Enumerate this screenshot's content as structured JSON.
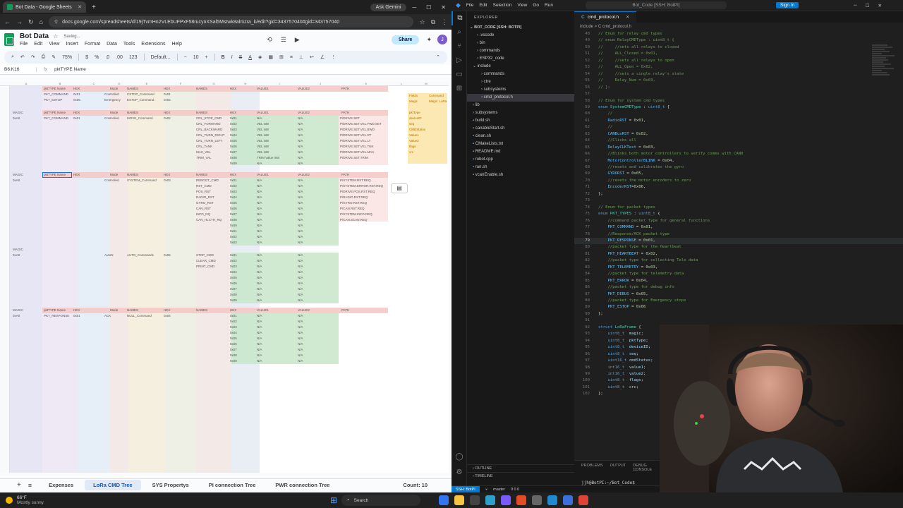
{
  "browser": {
    "tab_title": "Bot Data - Google Sheets",
    "new_tab": "+",
    "ask_gemini": "Ask Gemini",
    "url": "docs.google.com/spreadsheets/d/19jTvmHn2VLEbUFPxF58rucynXSal5Mstwk8almzra_k/edit?gid=343757040#gid=343757040"
  },
  "sheets": {
    "title": "Bot Data",
    "saving": "Saving...",
    "menus": [
      "File",
      "Edit",
      "View",
      "Insert",
      "Format",
      "Data",
      "Tools",
      "Extensions",
      "Help"
    ],
    "share": "Share",
    "avatar": "J",
    "toolbar": {
      "zoom": "75%",
      "font": "Default...",
      "font_size": "10",
      "currency": "$",
      "percent": "%",
      "decimals": ".0",
      "decimals2": ".00",
      "numfmt": "123",
      "bold": "B",
      "italic": "I",
      "strike": "S",
      "color": "A"
    },
    "namebox": "B6:K16",
    "formula": "pktTYPE Name",
    "col_letters": [
      "A",
      "B",
      "C",
      "D",
      "E",
      "F",
      "G",
      "H",
      "I",
      "J",
      "K",
      "L",
      "M"
    ],
    "sheet_tabs": [
      "Expenses",
      "LoRa CMD Tree",
      "SYS Propertys",
      "PI connection Tree",
      "PWR connection Tree"
    ],
    "count": "Count: 10",
    "rows": {
      "r1": [
        "pktTYPE Name",
        "HEX",
        "Mode",
        "NAMES",
        "HEX",
        "NAMES",
        "HEX",
        "VALUE1",
        "VALUE2",
        "PATH"
      ],
      "r2": [
        "PKT_COMMAND",
        "0x01",
        "Controlled",
        "CSTOP_Command",
        "0x01"
      ],
      "r3": [
        "PKT_ESTOP",
        "0x06",
        "Emergency",
        "ESTOP_Command",
        "0x02"
      ],
      "fields": [
        "Fields",
        "Command",
        "Magic",
        "Magic: LoRa"
      ],
      "field_list": [
        "pktType",
        "deviceID",
        "seq",
        "CMDStatus",
        "Value1",
        "Value2",
        "flags",
        "crc"
      ],
      "magic": "MAGIC",
      "magic_val": "0xA0",
      "drive_names": [
        "CRL_STOP_CMD",
        "CRL_FORWARD",
        "CRL_BACKWARD",
        "CRL_TURN_RIGHT",
        "CRL_TURN_LEFT",
        "CRL_TANK",
        "MAX_VEL",
        "TRIM_VAL"
      ],
      "drive_hex": [
        "0x01",
        "0x02",
        "0x03",
        "0x04",
        "0x05",
        "0x06",
        "0x07",
        "0x08",
        "0x09"
      ],
      "drive_v1": [
        "N/A",
        "VEL int8",
        "VEL int8",
        "VEL int8",
        "VEL int8",
        "VEL int8",
        "VEL int8",
        "TRIM Value int8",
        "N/A"
      ],
      "drive_paths": [
        "P/DRIVE.SET",
        "P/DRIVE.SET.VEL.FWD.SET",
        "P/DRIVE.SET.VEL.BWD",
        "P/DRIVE.SET.VEL.RT",
        "P/DRIVE.SET.VEL.LT",
        "P/DRIVE.SET.VEL.TNK",
        "P/DRIVE.SET.VEL.MAX",
        "P/DRIVE.SET.TRIM"
      ],
      "move": "MOVE_Command",
      "move_hex": "0x02",
      "sys_names": [
        "REBOOT_CMD",
        "RST_CMD",
        "POS_RST",
        "RADIO_RST",
        "GYRO_RST",
        "CAN_RST",
        "INFO_RQ",
        "CAN_HLCTH_RQ"
      ],
      "sys_paths": [
        "P/SYSTEM.RST.REQ",
        "P/SYSTEM.ERROR.RST.REQ",
        "P/DRIVE.POS.RST.REQ",
        "P/RADIO.RST.REQ",
        "P/GYRO.RST.REQ",
        "P/CAN.RST.REQ",
        "P/SYSTEM.INFO.REQ",
        "P/CAN.SCAN.REQ"
      ],
      "sys_cmd": "SYSTEM_Command",
      "sys_hex": "0x03",
      "auto": "AutoN",
      "auto_cmd": "AUTO_Commands",
      "auto_hex": "0x06",
      "auto_names": [
        "STOP_CMD",
        "CLEAR_CMD",
        "PRINT_CMD"
      ],
      "resp": "PKT_RESPONSE",
      "ack": "ACK",
      "null_cmd": "NULL_Command",
      "resp_hex": "0x04",
      "na": "N/A"
    }
  },
  "vscode": {
    "menus": [
      "File",
      "Edit",
      "Selection",
      "View",
      "Go",
      "Run"
    ],
    "search": "Bot_Code [SSH: BotPI]",
    "signin": "Sign In",
    "explorer_title": "EXPLORER",
    "root": "BOT_CODE [SSH: BOTPI]",
    "tree": [
      ".vscode",
      "bin",
      "commands",
      "ESP32_code",
      "include",
      "commands",
      "ctre",
      "subsystems",
      "cmd_protocol.h",
      "lib",
      "subsystems",
      "build.sh",
      "canableStart.sh",
      "clean.sh",
      "CMakeLists.txt",
      "README.md",
      "robot.cpp",
      "run.sh",
      "vcanEnable.sh"
    ],
    "outline": "OUTLINE",
    "timeline": "TIMELINE",
    "editor_tab": "cmd_protocol.h",
    "breadcrumb": "include > C cmd_protocol.h",
    "panel_tabs": [
      "PROBLEMS",
      "OUTPUT",
      "DEBUG CONSOLE"
    ],
    "terminal": "jjh@BotPI:~/Bot_Code$",
    "status": {
      "remote": "SSH: BotPI",
      "branch": "master",
      "problems": "0 0 0"
    },
    "lines": [
      {
        "n": "48",
        "t": "// Enum for relay cmd types",
        "k": "cm"
      },
      {
        "n": "49",
        "t": "// enum RelayCMDType : uint8_t {",
        "k": "cm"
      },
      {
        "n": "50",
        "t": "//     //sets all relays to closed",
        "k": "cm"
      },
      {
        "n": "51",
        "t": "//     ALL_Closed = 0x01,",
        "k": "cm"
      },
      {
        "n": "52",
        "t": "//     //sets all relays to open",
        "k": "cm"
      },
      {
        "n": "53",
        "t": "//     ALL_Open = 0x02,",
        "k": "cm"
      },
      {
        "n": "54",
        "t": "//     //sets a single relay's state",
        "k": "cm"
      },
      {
        "n": "55",
        "t": "//     Relay_Num = 0x03,",
        "k": "cm"
      },
      {
        "n": "56",
        "t": "// };",
        "k": "cm"
      },
      {
        "n": "57",
        "t": "",
        "k": "pl"
      },
      {
        "n": "58",
        "t": "// Enum for system cmd types",
        "k": "cm"
      },
      {
        "n": "59",
        "t": "enum SystemCMDType : uint8_t {",
        "k": "enum"
      },
      {
        "n": "60",
        "t": "    //",
        "k": "cm"
      },
      {
        "n": "61",
        "t": "    RadioRST = 0x01,",
        "k": "val"
      },
      {
        "n": "62",
        "t": "    //",
        "k": "cm"
      },
      {
        "n": "63",
        "t": "    CANBusRST = 0x02,",
        "k": "val"
      },
      {
        "n": "64",
        "t": "    //Clicks all",
        "k": "cm"
      },
      {
        "n": "65",
        "t": "    RelayCLKTest = 0x03,",
        "k": "val"
      },
      {
        "n": "66",
        "t": "    //Blinks both motor controllers to verify comms with CAN0",
        "k": "cm"
      },
      {
        "n": "67",
        "t": "    MotorControllerBLINK = 0x04,",
        "k": "val"
      },
      {
        "n": "68",
        "t": "    //resets and calibrates the gyro",
        "k": "cm"
      },
      {
        "n": "69",
        "t": "    GYRORST = 0x05,",
        "k": "val"
      },
      {
        "n": "70",
        "t": "    //resets the motor encoders to zero",
        "k": "cm"
      },
      {
        "n": "71",
        "t": "    EncoderRST=0x06,",
        "k": "val"
      },
      {
        "n": "72",
        "t": "};",
        "k": "pl"
      },
      {
        "n": "73",
        "t": "",
        "k": "pl"
      },
      {
        "n": "74",
        "t": "// Enum for packet types",
        "k": "cm"
      },
      {
        "n": "75",
        "t": "enum PKT_TYPES : uint8_t {",
        "k": "enum"
      },
      {
        "n": "76",
        "t": "    //command packet type for general functions",
        "k": "cm"
      },
      {
        "n": "77",
        "t": "    PKT_COMMAND = 0x01,",
        "k": "val"
      },
      {
        "n": "78",
        "t": "    //Response/ACK packet type",
        "k": "cm"
      },
      {
        "n": "79",
        "t": "    PKT_RESPONSE = 0x01,",
        "k": "val"
      },
      {
        "n": "80",
        "t": "    //packet type for the Heartbeat",
        "k": "cm"
      },
      {
        "n": "81",
        "t": "    PKT_HEARTBEAT = 0x02,",
        "k": "val"
      },
      {
        "n": "82",
        "t": "    //packet type for collecting Tele data",
        "k": "cm"
      },
      {
        "n": "83",
        "t": "    PKT_TELEMETRY = 0x03,",
        "k": "val"
      },
      {
        "n": "84",
        "t": "    //packet type for telemetry data",
        "k": "cm"
      },
      {
        "n": "85",
        "t": "    PKT_ERROR = 0x04,",
        "k": "val"
      },
      {
        "n": "86",
        "t": "    //packet type for debug info",
        "k": "cm"
      },
      {
        "n": "87",
        "t": "    PKT_DEBUG = 0x05,",
        "k": "val"
      },
      {
        "n": "88",
        "t": "    //packet type for Emergency stops",
        "k": "cm"
      },
      {
        "n": "89",
        "t": "    PKT_ESTOP = 0x06",
        "k": "val"
      },
      {
        "n": "90",
        "t": "};",
        "k": "pl"
      },
      {
        "n": "91",
        "t": "",
        "k": "pl"
      },
      {
        "n": "92",
        "t": "struct LoRaFrame {",
        "k": "struct"
      },
      {
        "n": "93",
        "t": "    uint8_t  magic;",
        "k": "field"
      },
      {
        "n": "94",
        "t": "    uint8_t  pktType;",
        "k": "field"
      },
      {
        "n": "95",
        "t": "    uint8_t  deviceID;",
        "k": "field"
      },
      {
        "n": "96",
        "t": "    uint8_t  seq;",
        "k": "field"
      },
      {
        "n": "97",
        "t": "    uint16_t cmdStatus;",
        "k": "field"
      },
      {
        "n": "98",
        "t": "    int16_t  value1;",
        "k": "field"
      },
      {
        "n": "99",
        "t": "    int16_t  value2;",
        "k": "field"
      },
      {
        "n": "100",
        "t": "    uint8_t  flags;",
        "k": "field"
      },
      {
        "n": "101",
        "t": "    uint8_t  crc;",
        "k": "field"
      },
      {
        "n": "102",
        "t": "};",
        "k": "pl"
      }
    ],
    "current_line": "79"
  },
  "taskbar": {
    "temp": "66°F",
    "weather": "Mostly sunny",
    "search": "Search"
  }
}
